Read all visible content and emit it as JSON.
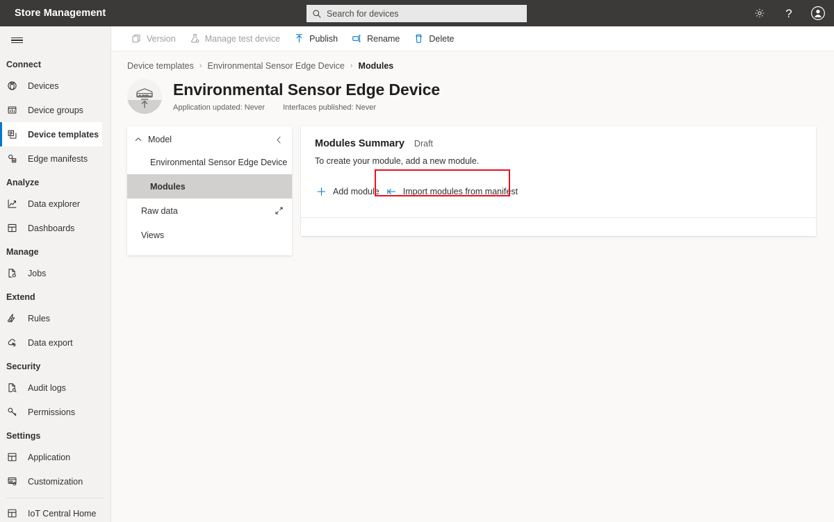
{
  "app": {
    "title": "Store Management",
    "accent_color": "#0078d4",
    "topbar_color": "#3b3a39",
    "highlight_color": "#e81123"
  },
  "search": {
    "placeholder": "Search for devices",
    "value": "",
    "icon": "search-icon"
  },
  "top_actions": [
    {
      "name": "settings",
      "icon": "gear-icon"
    },
    {
      "name": "help",
      "icon": "question-mark-icon",
      "glyph": "?"
    },
    {
      "name": "account",
      "icon": "user-account-icon"
    }
  ],
  "sidebar": {
    "menu_icon": "hamburger-icon",
    "groups": [
      {
        "title": "Connect",
        "items": [
          {
            "label": "Devices",
            "icon": "devices-icon",
            "selected": false
          },
          {
            "label": "Device groups",
            "icon": "device-groups-icon",
            "selected": false
          },
          {
            "label": "Device templates",
            "icon": "device-templates-icon",
            "selected": true
          },
          {
            "label": "Edge manifests",
            "icon": "edge-manifests-icon",
            "selected": false
          }
        ]
      },
      {
        "title": "Analyze",
        "items": [
          {
            "label": "Data explorer",
            "icon": "chart-line-icon",
            "selected": false
          },
          {
            "label": "Dashboards",
            "icon": "dashboard-grid-icon",
            "selected": false
          }
        ]
      },
      {
        "title": "Manage",
        "items": [
          {
            "label": "Jobs",
            "icon": "jobs-file-icon",
            "selected": false
          }
        ]
      },
      {
        "title": "Extend",
        "items": [
          {
            "label": "Rules",
            "icon": "rules-icon",
            "selected": false
          },
          {
            "label": "Data export",
            "icon": "cloud-export-icon",
            "selected": false
          }
        ]
      },
      {
        "title": "Security",
        "items": [
          {
            "label": "Audit logs",
            "icon": "audit-log-icon",
            "selected": false
          },
          {
            "label": "Permissions",
            "icon": "key-icon",
            "selected": false
          }
        ]
      },
      {
        "title": "Settings",
        "items": [
          {
            "label": "Application",
            "icon": "application-grid-icon",
            "selected": false
          },
          {
            "label": "Customization",
            "icon": "customization-icon",
            "selected": false
          }
        ]
      }
    ],
    "footer_items": [
      {
        "label": "IoT Central Home",
        "icon": "home-grid-icon",
        "selected": false
      }
    ]
  },
  "commandbar": {
    "buttons": [
      {
        "label": "Version",
        "icon": "version-copy-icon",
        "disabled": true
      },
      {
        "label": "Manage test device",
        "icon": "test-device-flask-icon",
        "disabled": true
      },
      {
        "label": "Publish",
        "icon": "publish-up-arrow-icon",
        "disabled": false
      },
      {
        "label": "Rename",
        "icon": "rename-icon",
        "disabled": false
      },
      {
        "label": "Delete",
        "icon": "trash-icon",
        "disabled": false
      }
    ]
  },
  "breadcrumb": {
    "items": [
      {
        "label": "Device templates",
        "current": false
      },
      {
        "label": "Environmental Sensor Edge Device",
        "current": false
      },
      {
        "label": "Modules",
        "current": true
      }
    ],
    "separator": "›"
  },
  "page_header": {
    "avatar_icon": "edge-device-upload-icon",
    "title": "Environmental Sensor Edge Device",
    "meta": [
      "Application updated: Never",
      "Interfaces published: Never"
    ]
  },
  "model_panel": {
    "header_label": "Model",
    "header_chevron": "chevron-up-icon",
    "collapse_icon": "chevron-left-icon",
    "items": [
      {
        "label": "Environmental Sensor Edge Device",
        "selected": false,
        "level": 2,
        "trailing_icon": ""
      },
      {
        "label": "Modules",
        "selected": true,
        "level": 2,
        "trailing_icon": ""
      },
      {
        "label": "Raw data",
        "selected": false,
        "level": 1,
        "trailing_icon": "expand-diagonal-icon"
      },
      {
        "label": "Views",
        "selected": false,
        "level": 1,
        "trailing_icon": ""
      }
    ]
  },
  "summary_card": {
    "title": "Modules Summary",
    "state": "Draft",
    "description": "To create your module, add a new module.",
    "actions": [
      {
        "label": "Add module",
        "icon": "plus-icon",
        "highlighted": false
      },
      {
        "label": "Import modules from manifest",
        "icon": "import-arrow-icon",
        "highlighted": true
      }
    ]
  }
}
